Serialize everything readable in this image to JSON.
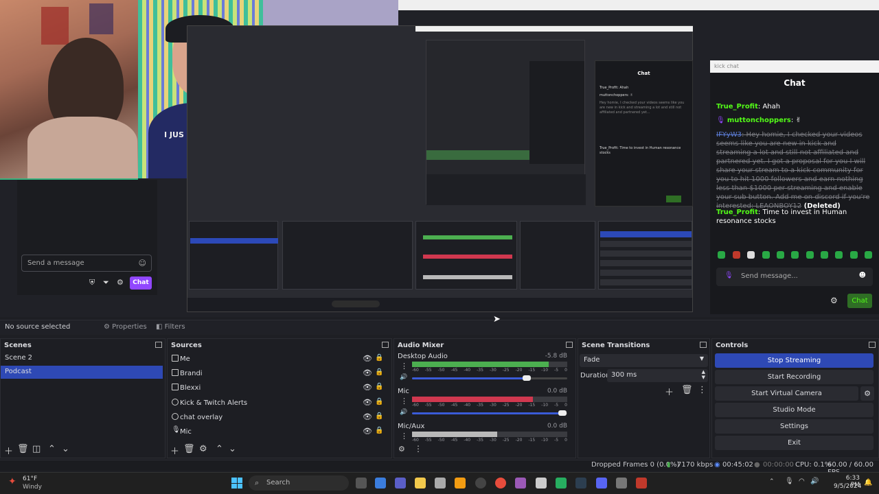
{
  "preview": {
    "cam2_shirt_text": "I JUS",
    "left_chat": {
      "input_placeholder": "Send a message",
      "chat_button": "Chat"
    },
    "nested_chat": {
      "title": "Chat",
      "lines": [
        "True_Profit: Ahah",
        "muttonchoppers: ✌",
        "Hey homie, I checked your videos seems like you are new in kick and streaming a lot and still not affiliated and partnered yet...",
        "True_Profit: Time to invest in Human resonance stocks"
      ]
    }
  },
  "kick_chat": {
    "window_title": "kick chat",
    "heading": "Chat",
    "messages": [
      {
        "user": "True_Profit",
        "sep": ": ",
        "text": "Ahah",
        "deleted": false
      },
      {
        "user": "muttonchoppers",
        "sep": ": ",
        "text": "✌",
        "deleted": false
      },
      {
        "user": "IFYyW3",
        "sep": ": ",
        "text": "Hey homie, I checked your videos seems like you are new in kick and streaming a lot and still not affiliated and partnered yet. I got a proposal for you I will share your stream to a kick community for you to hit 1000 followers and earn nothing less than $1000 per streaming and enable your sub button. Add me on discord if you're interested: LEAONBOY12",
        "suffix": " (Deleted)",
        "deleted": true
      },
      {
        "user": "True_Profit",
        "sep": ": ",
        "text": "Time to invest in Human resonance stocks",
        "deleted": false
      }
    ],
    "input_placeholder": "Send message...",
    "chat_button": "Chat"
  },
  "source_bar": {
    "no_source": "No source selected",
    "properties": "Properties",
    "filters": "Filters"
  },
  "docks": {
    "scenes": {
      "title": "Scenes",
      "items": [
        {
          "label": "Scene 2",
          "active": false
        },
        {
          "label": "Podcast",
          "active": true
        }
      ]
    },
    "sources": {
      "title": "Sources",
      "items": [
        {
          "label": "Me",
          "icon": "monitor-icon"
        },
        {
          "label": "Brandi",
          "icon": "monitor-icon"
        },
        {
          "label": "Blexxi",
          "icon": "monitor-icon"
        },
        {
          "label": "Kick & Twitch Alerts",
          "icon": "globe-icon"
        },
        {
          "label": "chat overlay",
          "icon": "globe-icon"
        },
        {
          "label": "Mic",
          "icon": "microphone-icon"
        }
      ]
    },
    "mixer": {
      "title": "Audio Mixer",
      "tracks": [
        {
          "name": "Desktop Audio",
          "db": "-5.8 dB",
          "level": 0.88,
          "volume": 0.74,
          "color": "#4caf50"
        },
        {
          "name": "Mic",
          "db": "0.0 dB",
          "level": 0.78,
          "volume": 0.97,
          "color": "#d0384f"
        },
        {
          "name": "Mic/Aux",
          "db": "0.0 dB",
          "level": 0.55,
          "volume": 0.97,
          "color": "#b9b9b9"
        }
      ],
      "ticks": [
        "-60",
        "-55",
        "-50",
        "-45",
        "-40",
        "-35",
        "-30",
        "-25",
        "-20",
        "-15",
        "-10",
        "-5",
        "0"
      ]
    },
    "transitions": {
      "title": "Scene Transitions",
      "selected": "Fade",
      "duration_label": "Duration",
      "duration_value": "300 ms"
    },
    "controls": {
      "title": "Controls",
      "buttons": [
        {
          "label": "Stop Streaming",
          "active": true
        },
        {
          "label": "Start Recording",
          "active": false
        },
        {
          "label": "Start Virtual Camera",
          "active": false
        },
        {
          "label": "Studio Mode",
          "active": false
        },
        {
          "label": "Settings",
          "active": false
        },
        {
          "label": "Exit",
          "active": false
        }
      ]
    }
  },
  "status": {
    "dropped_frames": "Dropped Frames 0 (0.0%)",
    "bitrate": "7170 kbps",
    "stream_time": "00:45:02",
    "rec_time": "00:00:00",
    "cpu": "CPU: 0.1%",
    "fps": "60.00 / 60.00 FPS"
  },
  "taskbar": {
    "weather_temp": "61°F",
    "weather_desc": "Windy",
    "search_placeholder": "Search",
    "time": "6:33 PM",
    "date": "9/5/2024"
  },
  "colors": {
    "accent_blue": "#2e49b5",
    "kick_green": "#53fc18",
    "twitch_purple": "#9147ff"
  }
}
